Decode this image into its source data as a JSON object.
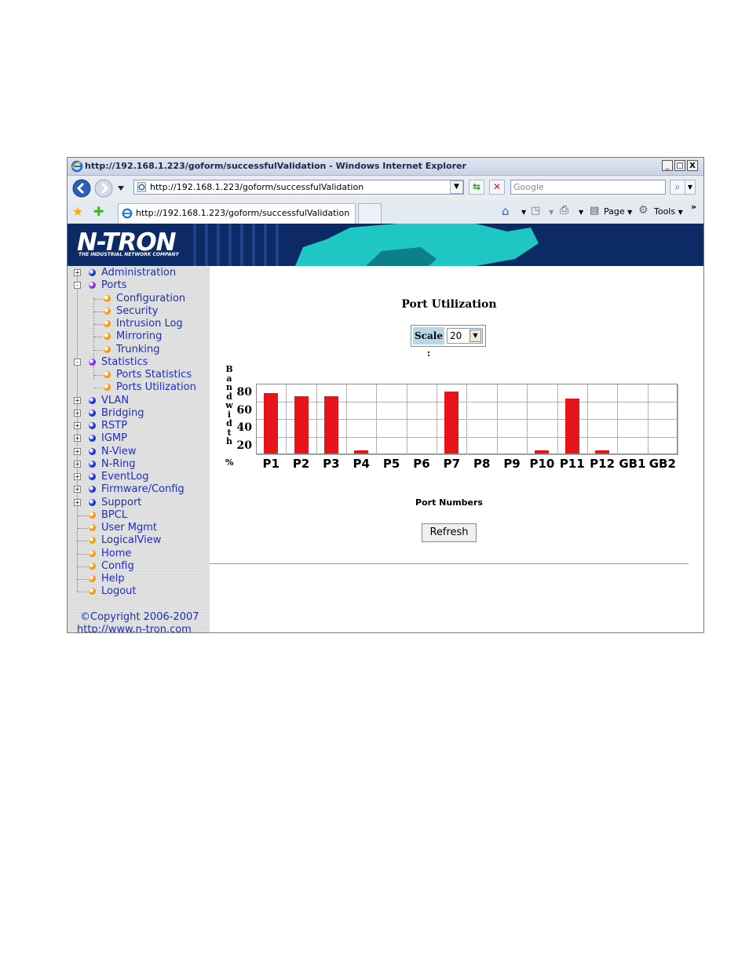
{
  "window": {
    "title": "http://192.168.1.223/goform/successfulValidation - Windows Internet Explorer",
    "url": "http://192.168.1.223/goform/successfulValidation",
    "search_placeholder": "Google",
    "tab_title": "http://192.168.1.223/goform/successfulValidation",
    "toolbar": {
      "page": "Page",
      "tools": "Tools",
      "more": "»"
    },
    "controls": {
      "minimize": "_",
      "maximize": "□",
      "close": "X"
    }
  },
  "banner": {
    "logo": "N-TRON",
    "tagline": "THE INDUSTRIAL NETWORK COMPANY"
  },
  "sidebar": {
    "items": [
      {
        "label": "Administration",
        "level": 0,
        "expander": "+",
        "color": "#1f2fd6"
      },
      {
        "label": "Ports",
        "level": 0,
        "expander": "-",
        "color": "#8a2be2"
      },
      {
        "label": "Configuration",
        "level": 1,
        "color": "#f29b12"
      },
      {
        "label": "Security",
        "level": 1,
        "color": "#f29b12"
      },
      {
        "label": "Intrusion Log",
        "level": 1,
        "color": "#f29b12"
      },
      {
        "label": "Mirroring",
        "level": 1,
        "color": "#f29b12"
      },
      {
        "label": "Trunking",
        "level": 1,
        "color": "#f29b12"
      },
      {
        "label": "Statistics",
        "level": 0,
        "expander": "-",
        "color": "#8a2be2"
      },
      {
        "label": "Ports Statistics",
        "level": 1,
        "color": "#f29b12"
      },
      {
        "label": "Ports Utilization",
        "level": 1,
        "color": "#f29b12"
      },
      {
        "label": "VLAN",
        "level": 0,
        "expander": "+",
        "color": "#1f2fd6"
      },
      {
        "label": "Bridging",
        "level": 0,
        "expander": "+",
        "color": "#1f2fd6"
      },
      {
        "label": "RSTP",
        "level": 0,
        "expander": "+",
        "color": "#1f2fd6"
      },
      {
        "label": "IGMP",
        "level": 0,
        "expander": "+",
        "color": "#1f2fd6"
      },
      {
        "label": "N-View",
        "level": 0,
        "expander": "+",
        "color": "#1f2fd6"
      },
      {
        "label": "N-Ring",
        "level": 0,
        "expander": "+",
        "color": "#1f2fd6"
      },
      {
        "label": "EventLog",
        "level": 0,
        "expander": "+",
        "color": "#1f2fd6"
      },
      {
        "label": "Firmware/Config",
        "level": 0,
        "expander": "+",
        "color": "#1f2fd6"
      },
      {
        "label": "Support",
        "level": 0,
        "expander": "+",
        "color": "#1f2fd6"
      },
      {
        "label": "BPCL",
        "level": 0,
        "color": "#f29b12"
      },
      {
        "label": "User Mgmt",
        "level": 0,
        "color": "#f29b12"
      },
      {
        "label": "LogicalView",
        "level": 0,
        "color": "#f29b12"
      },
      {
        "label": "Home",
        "level": 0,
        "color": "#f29b12"
      },
      {
        "label": "Config",
        "level": 0,
        "color": "#f29b12"
      },
      {
        "label": "Help",
        "level": 0,
        "color": "#f29b12"
      },
      {
        "label": "Logout",
        "level": 0,
        "color": "#f29b12"
      }
    ],
    "copyright": "©Copyright 2006-2007",
    "website": "http://www.n-tron.com"
  },
  "content": {
    "title": "Port Utilization",
    "scale_label": "Scale :",
    "scale_value": "20",
    "x_label": "Port Numbers",
    "refresh_label": "Refresh"
  },
  "chart_data": {
    "type": "bar",
    "title": "Port Utilization",
    "xlabel": "Port Numbers",
    "ylabel": "Bandwidth %",
    "ylabel_chars": [
      "B",
      "a",
      "n",
      "d",
      "w",
      "i",
      "d",
      "t",
      "h",
      "",
      "%"
    ],
    "categories": [
      "P1",
      "P2",
      "P3",
      "P4",
      "P5",
      "P6",
      "P7",
      "P8",
      "P9",
      "P10",
      "P11",
      "P12",
      "GB1",
      "GB2"
    ],
    "values": [
      70,
      66,
      66,
      4,
      0,
      0,
      72,
      0,
      0,
      4,
      64,
      4,
      0,
      0
    ],
    "yticks": [
      80,
      60,
      40,
      20
    ],
    "ylim": [
      0,
      80
    ],
    "bar_color": "#e8141b",
    "grid": true
  }
}
